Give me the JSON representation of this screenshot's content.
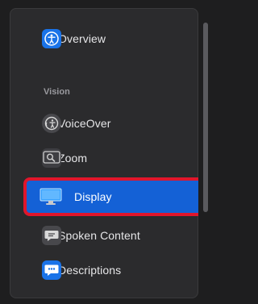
{
  "sidebar": {
    "overview": {
      "label": "Overview",
      "icon": "accessibility-person-icon"
    },
    "section_vision": "Vision",
    "items": [
      {
        "label": "VoiceOver",
        "icon": "voiceover-icon"
      },
      {
        "label": "Zoom",
        "icon": "zoom-magnifier-icon"
      },
      {
        "label": "Display",
        "icon": "display-monitor-icon",
        "selected": true
      },
      {
        "label": "Spoken Content",
        "icon": "spoken-content-bubble-icon"
      },
      {
        "label": "Descriptions",
        "icon": "descriptions-bubble-icon"
      }
    ]
  },
  "colors": {
    "background": "#1e1e1f",
    "sidebar": "#2b2b2d",
    "selected_row": "#1461d6",
    "highlight_box": "#e0162c",
    "accent_blue": "#2b8cf7"
  }
}
